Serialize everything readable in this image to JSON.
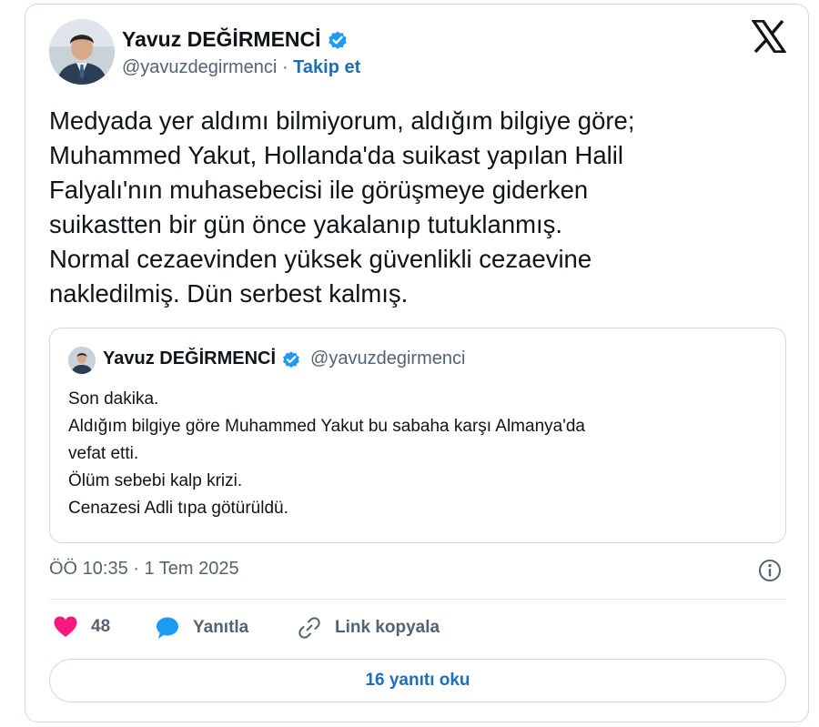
{
  "post": {
    "author": {
      "name": "Yavuz DEĞİRMENCİ",
      "handle": "@yavuzdegirmenci",
      "separator": "·",
      "follow_label": "Takip et",
      "verified_icon": "verified-badge-icon"
    },
    "brand_icon": "x-logo-icon",
    "text_lines": [
      "Medyada yer aldımı bilmiyorum, aldığım bilgiye göre;",
      "Muhammed Yakut, Hollanda'da suikast yapılan Halil",
      "Falyalı'nın muhasebecisi ile görüşmeye giderken",
      "suikastten bir gün önce yakalanıp tutuklanmış.",
      "Normal cezaevinden yüksek güvenlikli cezaevine",
      "nakledilmiş. Dün serbest kalmış."
    ],
    "quoted": {
      "name": "Yavuz DEĞİRMENCİ",
      "handle": "@yavuzdegirmenci",
      "text_lines": [
        "Son dakika.",
        "Aldığım bilgiye göre Muhammed Yakut bu sabaha karşı Almanya'da",
        "vefat etti.",
        "Ölüm sebebi kalp krizi.",
        "Cenazesi Adli tıpa götürüldü."
      ]
    },
    "timestamp": "ÖÖ 10:35 · 1 Tem 2025",
    "actions": {
      "like_count": "48",
      "reply_label": "Yanıtla",
      "copy_link_label": "Link kopyala"
    },
    "read_replies_label": "16 yanıtı oku"
  },
  "colors": {
    "accent": "#1d9bf0",
    "link": "#1d6fb5",
    "heart": "#f91880",
    "text_secondary": "#536471",
    "border": "#cfd9de"
  }
}
